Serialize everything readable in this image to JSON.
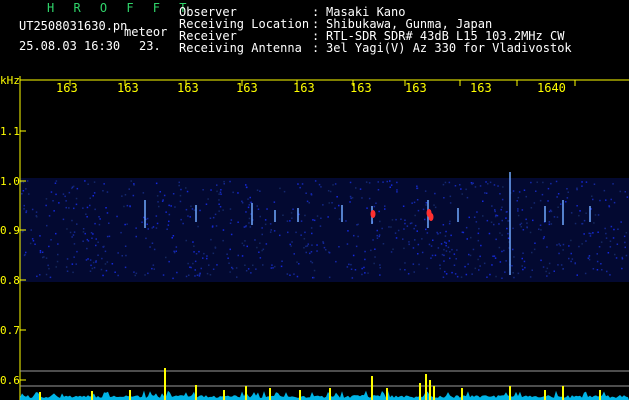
{
  "header": {
    "app_title": "H R O F F T",
    "file_name": "UT2508031630.pn",
    "file_mode": "meteor",
    "rec_date": "25.08.03 16:30",
    "rec_value": "23.",
    "info": [
      {
        "label": "Observer",
        "value": "Masaki Kano"
      },
      {
        "label": "Receiving Location",
        "value": "Shibukawa, Gunma, Japan"
      },
      {
        "label": "Receiver",
        "value": "RTL-SDR SDR# 43dB L15 103.2MHz CW"
      },
      {
        "label": "Receiving Antenna",
        "value": "3el Yagi(V) Az 330 for Vladivostok"
      }
    ],
    "separator": ":"
  },
  "plot": {
    "unit_label": "kHz",
    "y_ticks": [
      "1.1",
      "1.0",
      "0.9",
      "0.8",
      "0.7",
      "0.6"
    ],
    "time_ticks": [
      "163",
      "163",
      "163",
      "163",
      "163",
      "163",
      "163",
      "163",
      "1640"
    ]
  },
  "colors": {
    "background": "#000000",
    "header_title": "#2fd46a",
    "header_text": "#ffffff",
    "tick_text": "#ffff00",
    "axis": "#ffff00",
    "noise_band": "#0a1a8c",
    "echo": "#ff3030",
    "spectrum_base": "#00c8ff",
    "spectrum_peak": "#ffff00"
  }
}
